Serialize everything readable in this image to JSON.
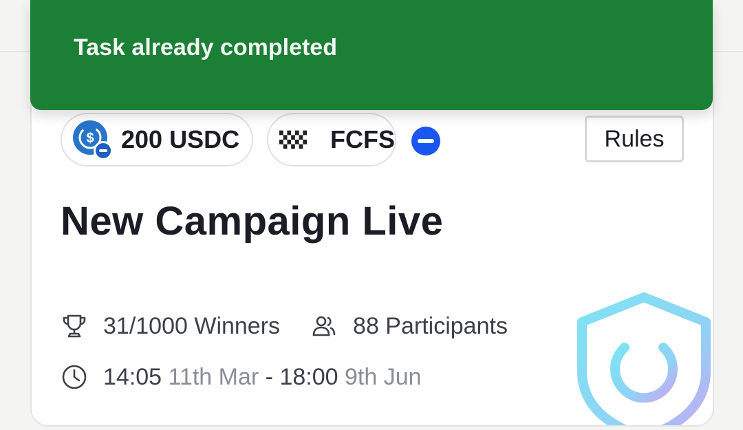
{
  "toast": {
    "message": "Task already completed",
    "color": "#1b7f36"
  },
  "campaign": {
    "reward_label": "200 USDC",
    "reward_icon": "usdc-coin-icon",
    "type_label": "FCFS",
    "type_icon": "checkered-flag-icon",
    "chain_icon": "chain-minus-icon",
    "rules_label": "Rules",
    "title": "New Campaign Live",
    "winners": "31/1000 Winners",
    "participants": "88 Participants",
    "start_time": "14:05",
    "start_date": "11th Mar",
    "separator": "-",
    "end_time": "18:00",
    "end_date": "9th Jun",
    "graphic_icon": "shield-power-icon"
  }
}
